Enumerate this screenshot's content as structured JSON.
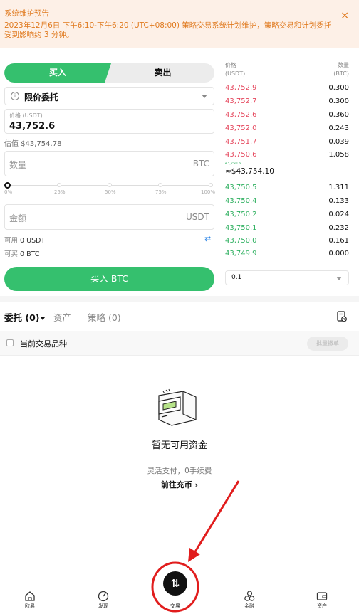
{
  "banner": {
    "title": "系统维护预告",
    "text": "2023年12月6日 下午6:10-下午6:20 (UTC+08:00) 策略交易系统计划维护，策略交易和计划委托受到影响约 3 分钟。",
    "close": "×"
  },
  "trade_tabs": {
    "buy": "买入",
    "sell": "卖出"
  },
  "order_form": {
    "order_type": "限价委托",
    "price_label": "价格 (USDT)",
    "price_value": "43,752.6",
    "estimate": "估值 $43,754.78",
    "qty_placeholder": "数量",
    "qty_unit": "BTC",
    "slider_labels": [
      "0%",
      "25%",
      "50%",
      "75%",
      "100%"
    ],
    "slider_level_percent": 0,
    "amount_placeholder": "金额",
    "amount_unit": "USDT",
    "available_label": "可用",
    "available_value": "0 USDT",
    "buyable_label": "可买",
    "buyable_value": "0 BTC",
    "swap_icon": "⇄",
    "submit": "买入 BTC"
  },
  "order_book": {
    "price_header": "价格\n(USDT)",
    "qty_header": "数量\n(BTC)",
    "asks": [
      {
        "price": "43,752.9",
        "qty": "0.300"
      },
      {
        "price": "43,752.7",
        "qty": "0.300"
      },
      {
        "price": "43,752.6",
        "qty": "0.360"
      },
      {
        "price": "43,752.0",
        "qty": "0.243"
      },
      {
        "price": "43,751.7",
        "qty": "0.039"
      },
      {
        "price": "43,750.6",
        "qty": "1.058"
      }
    ],
    "mid_small": "43,750.6",
    "mid_price": "≈$43,754.10",
    "bids": [
      {
        "price": "43,750.5",
        "qty": "1.311"
      },
      {
        "price": "43,750.4",
        "qty": "0.133"
      },
      {
        "price": "43,750.2",
        "qty": "0.024"
      },
      {
        "price": "43,750.1",
        "qty": "0.232"
      },
      {
        "price": "43,750.0",
        "qty": "0.161"
      },
      {
        "price": "43,749.9",
        "qty": "0.000"
      }
    ],
    "depth": "0.1",
    "colors": {
      "ask": "#e5475d",
      "bid": "#2fb060"
    }
  },
  "sub_tabs": {
    "orders": "委托 (0)",
    "assets": "资产",
    "strategy": "策略 (0)"
  },
  "filter": {
    "label": "当前交易品种",
    "cancel_all": "批量撤单"
  },
  "empty": {
    "title": "暂无可用资金",
    "subtitle": "灵活支付，0手续费",
    "link": "前往充币 ›"
  },
  "nav": {
    "items": [
      {
        "label": "欧易",
        "icon": "home-icon"
      },
      {
        "label": "发现",
        "icon": "discover-icon"
      },
      {
        "label": "交易",
        "icon": "trade-icon"
      },
      {
        "label": "金融",
        "icon": "finance-icon"
      },
      {
        "label": "资产",
        "icon": "wallet-icon"
      }
    ]
  },
  "accent": "#35c06e",
  "annotation_color": "#e11d1d"
}
